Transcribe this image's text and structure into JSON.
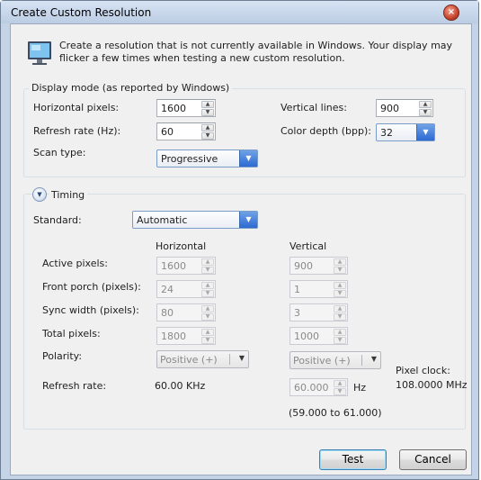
{
  "window": {
    "title": "Create Custom Resolution",
    "close_glyph": "×"
  },
  "intro": {
    "icon": "monitor-icon",
    "text": "Create a resolution that is not currently available in Windows. Your display may flicker a few times when testing a new custom resolution."
  },
  "display_mode": {
    "title": "Display mode (as reported by Windows)",
    "horizontal_pixels": {
      "label": "Horizontal pixels:",
      "value": "1600"
    },
    "vertical_lines": {
      "label": "Vertical lines:",
      "value": "900"
    },
    "refresh_rate": {
      "label": "Refresh rate (Hz):",
      "value": "60"
    },
    "color_depth": {
      "label": "Color depth (bpp):",
      "value": "32"
    },
    "scan_type": {
      "label": "Scan type:",
      "value": "Progressive"
    }
  },
  "timing": {
    "title": "Timing",
    "toggle_icon": "collapse-chevron-icon",
    "standard": {
      "label": "Standard:",
      "value": "Automatic"
    },
    "horizontal_header": "Horizontal",
    "vertical_header": "Vertical",
    "rows": {
      "active_pixels": {
        "label": "Active pixels:",
        "h": "1600",
        "v": "900"
      },
      "front_porch": {
        "label": "Front porch (pixels):",
        "h": "24",
        "v": "1"
      },
      "sync_width": {
        "label": "Sync width (pixels):",
        "h": "80",
        "v": "3"
      },
      "total_pixels": {
        "label": "Total pixels:",
        "h": "1800",
        "v": "1000"
      }
    },
    "polarity": {
      "label": "Polarity:",
      "h": "Positive (+)",
      "v": "Positive (+)"
    },
    "refresh_rate": {
      "label": "Refresh rate:",
      "h": "60.00 KHz",
      "v": "60.000",
      "v_unit": "Hz",
      "range": "(59.000 to 61.000)"
    },
    "pixel_clock": {
      "label": "Pixel clock:",
      "value": "108.0000 MHz"
    }
  },
  "buttons": {
    "test": "Test",
    "cancel": "Cancel"
  }
}
